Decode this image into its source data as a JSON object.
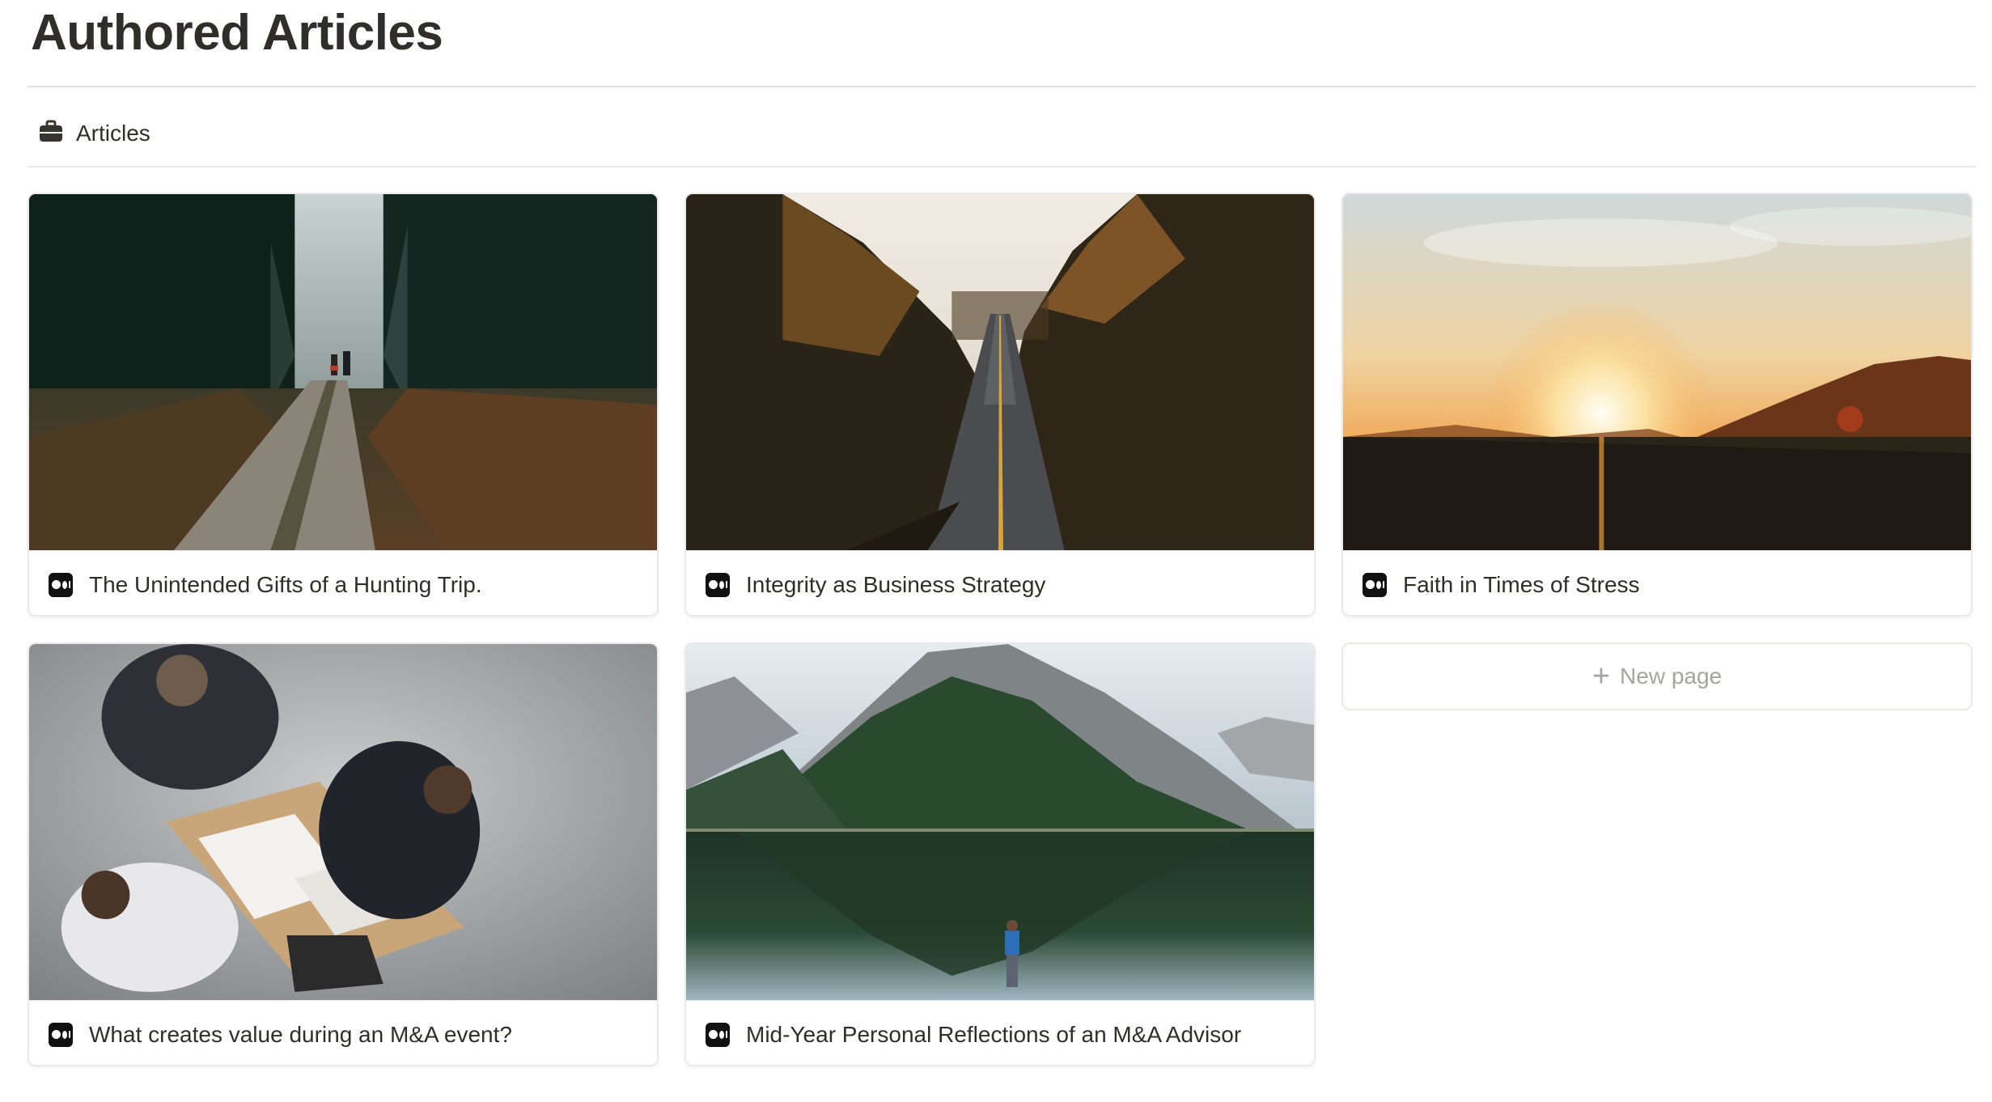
{
  "page": {
    "title": "Authored Articles"
  },
  "view_tab": {
    "icon": "briefcase-icon",
    "label": "Articles"
  },
  "cards": [
    {
      "title": "The Unintended Gifts of a Hunting Trip.",
      "icon": "medium-icon",
      "cover": "forest path with two hikers"
    },
    {
      "title": "Integrity as Business Strategy",
      "icon": "medium-icon",
      "cover": "long road through autumn trees"
    },
    {
      "title": "Faith in Times of Stress",
      "icon": "medium-icon",
      "cover": "sunset over hills"
    },
    {
      "title": "What creates value during an M&A event?",
      "icon": "medium-icon",
      "cover": "business meeting seen from above"
    },
    {
      "title": "Mid-Year Personal Reflections of an M&A Advisor",
      "icon": "medium-icon",
      "cover": "mountain reflected in lake"
    }
  ],
  "new_page": {
    "icon": "plus-icon",
    "label": "New page"
  }
}
